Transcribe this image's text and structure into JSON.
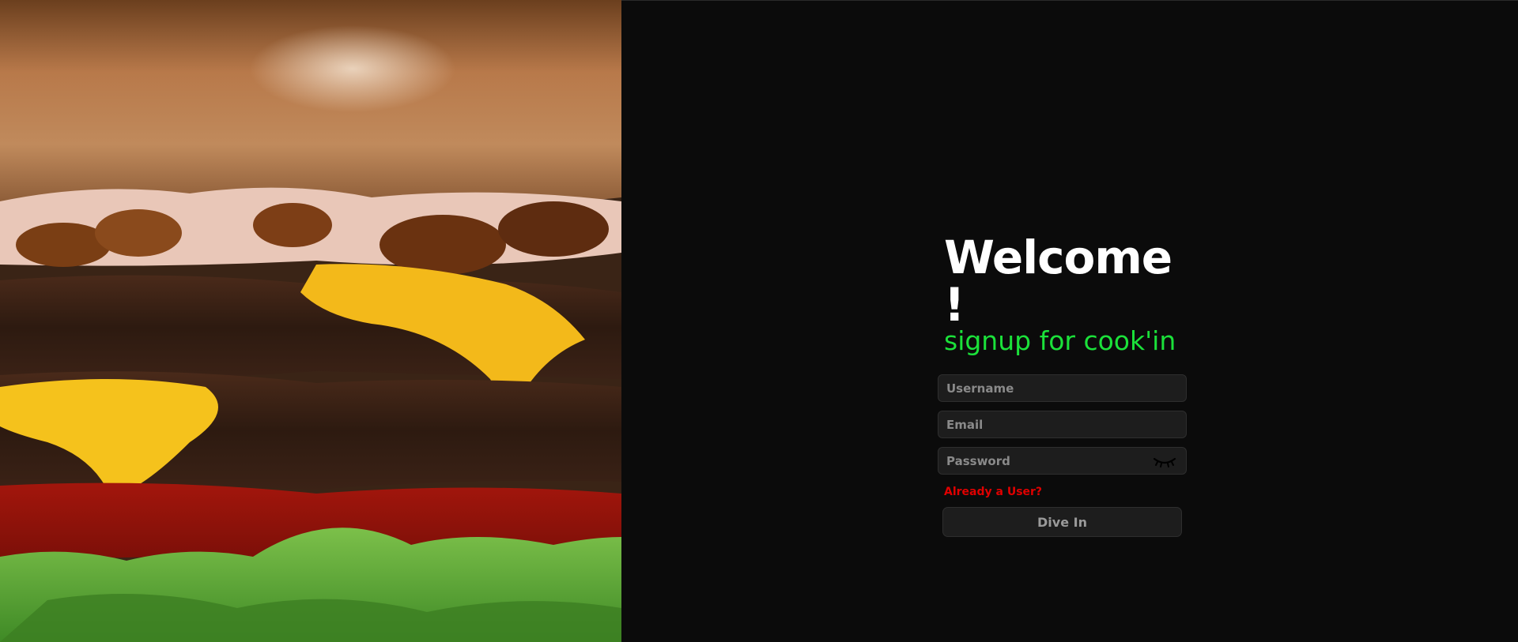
{
  "hero": {
    "image": "burger-closeup",
    "alt": ""
  },
  "form": {
    "title": "Welcome !",
    "subtitle": "signup for cook'in",
    "username_placeholder": "Username",
    "email_placeholder": "Email",
    "password_placeholder": "Password",
    "password_toggle_icon": "eye-closed-icon",
    "login_link": "Already a User?",
    "submit_label": "Dive In"
  },
  "colors": {
    "background": "#0b0b0b",
    "accent_green": "#1be13a",
    "link_red": "#e00000",
    "field_bg": "#1d1d1d"
  }
}
